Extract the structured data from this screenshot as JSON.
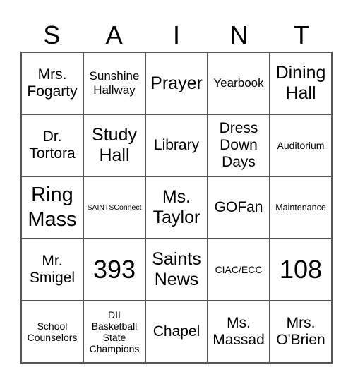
{
  "title_letters": [
    "S",
    "A",
    "I",
    "N",
    "T"
  ],
  "cells": [
    [
      "Mrs. Fogarty",
      "Sunshine Hallway",
      "Prayer",
      "Yearbook",
      "Dining Hall"
    ],
    [
      "Dr. Tortora",
      "Study Hall",
      "Library",
      "Dress Down Days",
      "Auditorium"
    ],
    [
      "Ring Mass",
      "SAINTSConnect",
      "Ms. Taylor",
      "GOFan",
      "Maintenance"
    ],
    [
      "Mr. Smigel",
      "393",
      "Saints News",
      "CIAC/ECC",
      "108"
    ],
    [
      "School Counselors",
      "DII Basketball State Champions",
      "Chapel",
      "Ms. Massad",
      "Mrs. O'Brien"
    ]
  ],
  "border_color": "#555555"
}
